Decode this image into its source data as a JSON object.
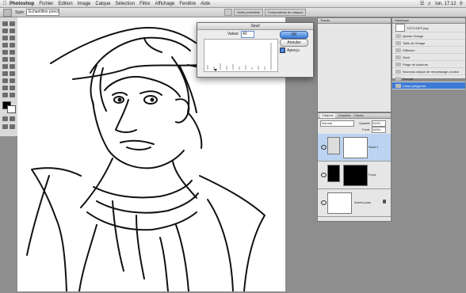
{
  "menubar": {
    "app": "Photoshop",
    "items": [
      "Fichier",
      "Edition",
      "Image",
      "Calque",
      "Sélection",
      "Filtre",
      "Affichage",
      "Fenêtre",
      "Aide"
    ],
    "clock": "lun. 17:12"
  },
  "options": {
    "label": "Style",
    "select_value": "Echantillon ponctuel",
    "workspace_buttons": [
      "Outils prédéfinis",
      "Compositions de calques"
    ]
  },
  "dialog": {
    "title": "Seuil",
    "value_label": "Valeur",
    "value": "40",
    "ok_label": "OK",
    "cancel_label": "Annuler",
    "preview_label": "Aperçu"
  },
  "history": {
    "tab": "Historique",
    "snapshot": "TUTO-DEF.png",
    "items": [
      "Ajuster l'image",
      "Taille de l'image",
      "Diffusion",
      "Seuil",
      "Plage de couleurs",
      "Nouveau calque de remplissage couleur",
      "Remplir",
      "Lasso polygonal"
    ],
    "selected_index": 7
  },
  "actions": {
    "tab": "Tracés"
  },
  "layers": {
    "tabs": [
      "Calques",
      "Couches",
      "Tracés"
    ],
    "blend_mode": "Normal",
    "opacity_label": "Opacité",
    "opacity": "100%",
    "fill_label": "Fond",
    "fill": "100%",
    "rows": [
      {
        "name": "Seuil 1",
        "selected": true
      },
      {
        "name": "Fond",
        "selected": false
      },
      {
        "name": "Arrière-plan",
        "selected": false
      }
    ]
  },
  "colors": {
    "selection_blue": "#3d7ad6",
    "layer_highlight": "#bcd3f2"
  }
}
